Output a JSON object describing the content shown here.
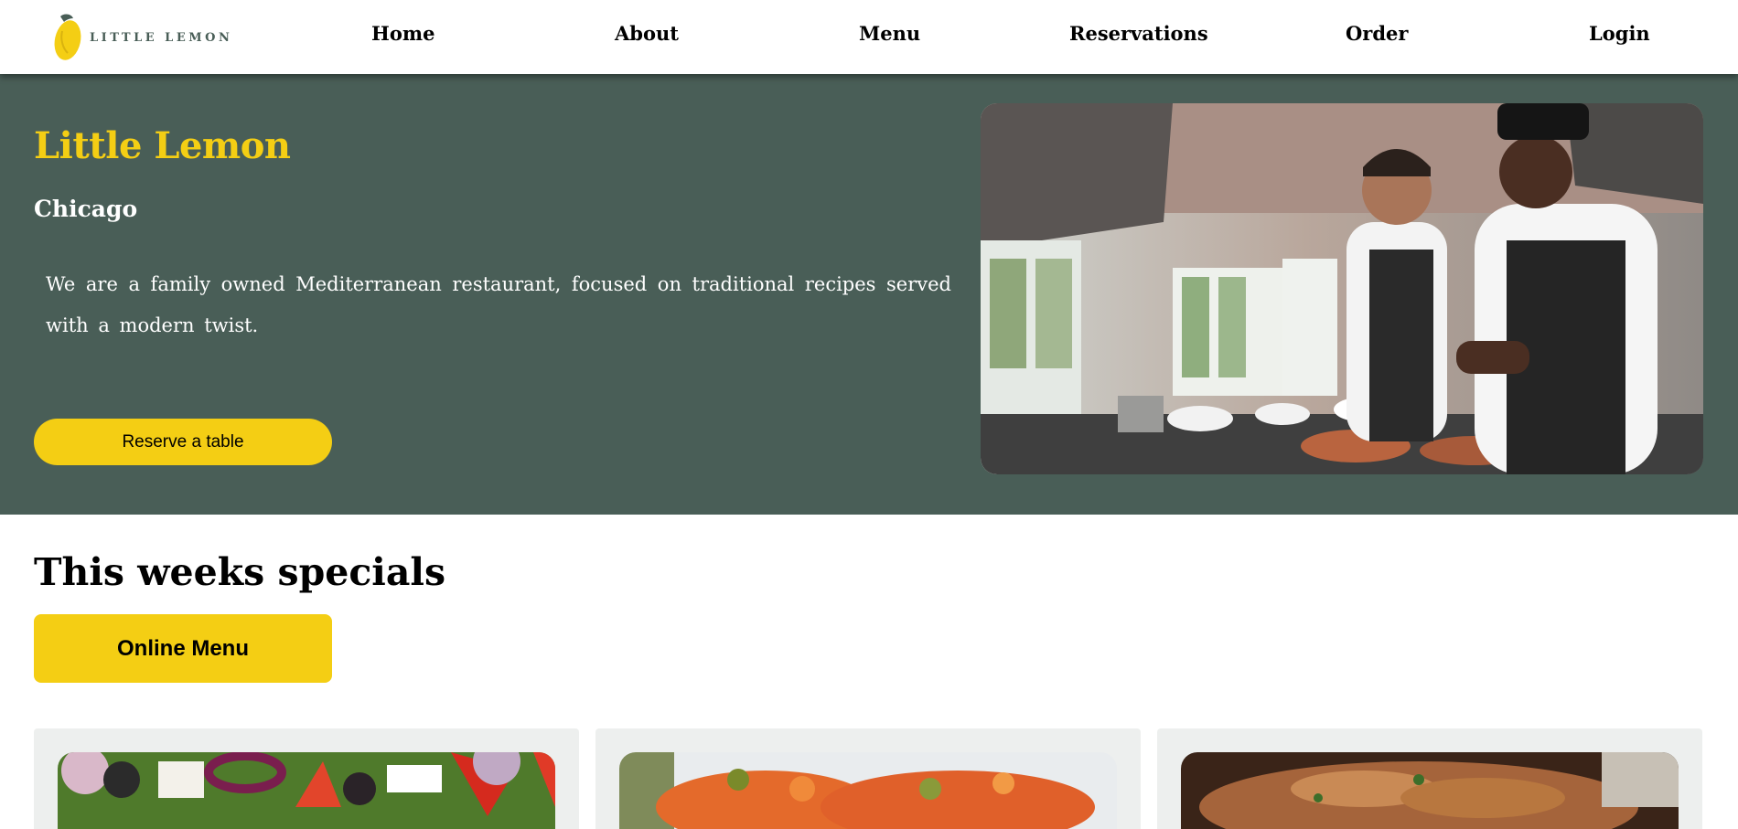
{
  "brand": {
    "logo_text": "LITTLE LEMON",
    "colors": {
      "primary_green": "#495e57",
      "primary_yellow": "#f4ce14",
      "card_gray": "#edefee"
    }
  },
  "nav": {
    "items": [
      {
        "label": "Home"
      },
      {
        "label": "About"
      },
      {
        "label": "Menu"
      },
      {
        "label": "Reservations"
      },
      {
        "label": "Order"
      },
      {
        "label": "Login"
      }
    ]
  },
  "hero": {
    "title": "Little Lemon",
    "subtitle": "Chicago",
    "description": "We are a family owned Mediterranean restaurant, focused on traditional recipes served with a modern twist.",
    "cta_label": "Reserve a table",
    "image_icon": "chefs-in-kitchen-photo"
  },
  "specials": {
    "title": "This weeks specials",
    "menu_button_label": "Online Menu",
    "cards": [
      {
        "image_icon": "greek-salad-photo"
      },
      {
        "image_icon": "bruschetta-photo"
      },
      {
        "image_icon": "grilled-dish-photo"
      }
    ]
  }
}
